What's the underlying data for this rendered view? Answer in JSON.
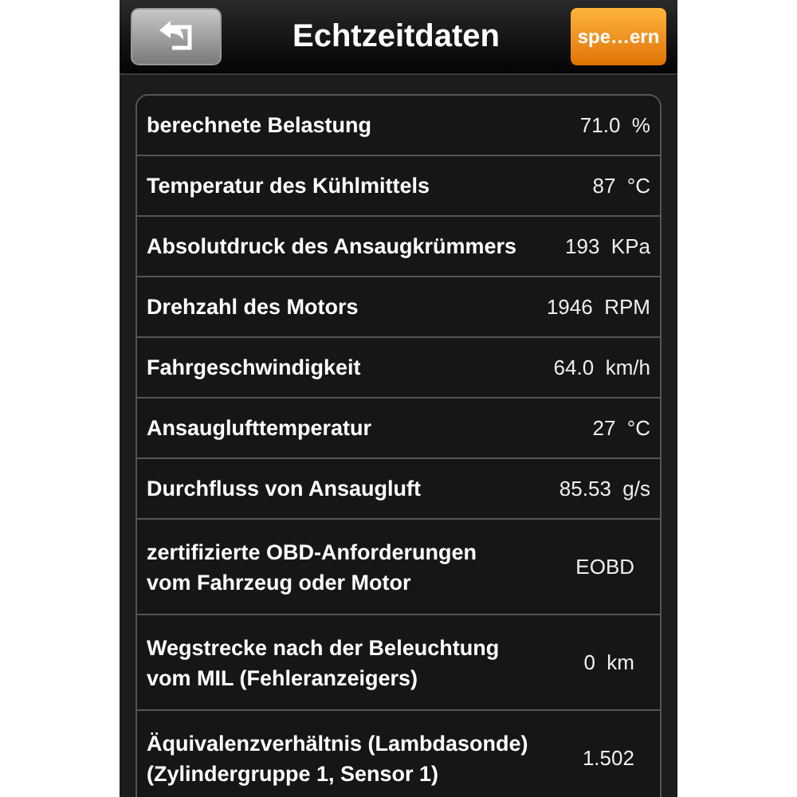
{
  "header": {
    "back_button": {
      "kind": "back"
    },
    "title": "Echtzeitdaten",
    "action_button": {
      "label": "spe…ern"
    }
  },
  "rows": [
    {
      "label": "berechnete Belastung",
      "value": "71.0  %"
    },
    {
      "label": "Temperatur des Kühlmittels",
      "value": "87  °C"
    },
    {
      "label": "Absolutdruck des Ansaugkrümmers",
      "value": "193  KPa"
    },
    {
      "label": "Drehzahl des Motors",
      "value": "1946  RPM"
    },
    {
      "label": "Fahrgeschwindigkeit",
      "value": "64.0  km/h"
    },
    {
      "label": "Ansauglufttemperatur",
      "value": "27  °C"
    },
    {
      "label": "Durchfluss von Ansaugluft",
      "value": "85.53  g/s"
    },
    {
      "label": "zertifizierte OBD-Anforderungen\nvom Fahrzeug oder Motor",
      "value": "EOBD"
    },
    {
      "label": "Wegstrecke nach der Beleuchtung\nvom MIL (Fehleranzeigers)",
      "value": "0  km"
    },
    {
      "label": "Äquivalenzverhältnis (Lambdasonde)\n(Zylindergruppe 1, Sensor 1)",
      "value": "1.502"
    }
  ]
}
